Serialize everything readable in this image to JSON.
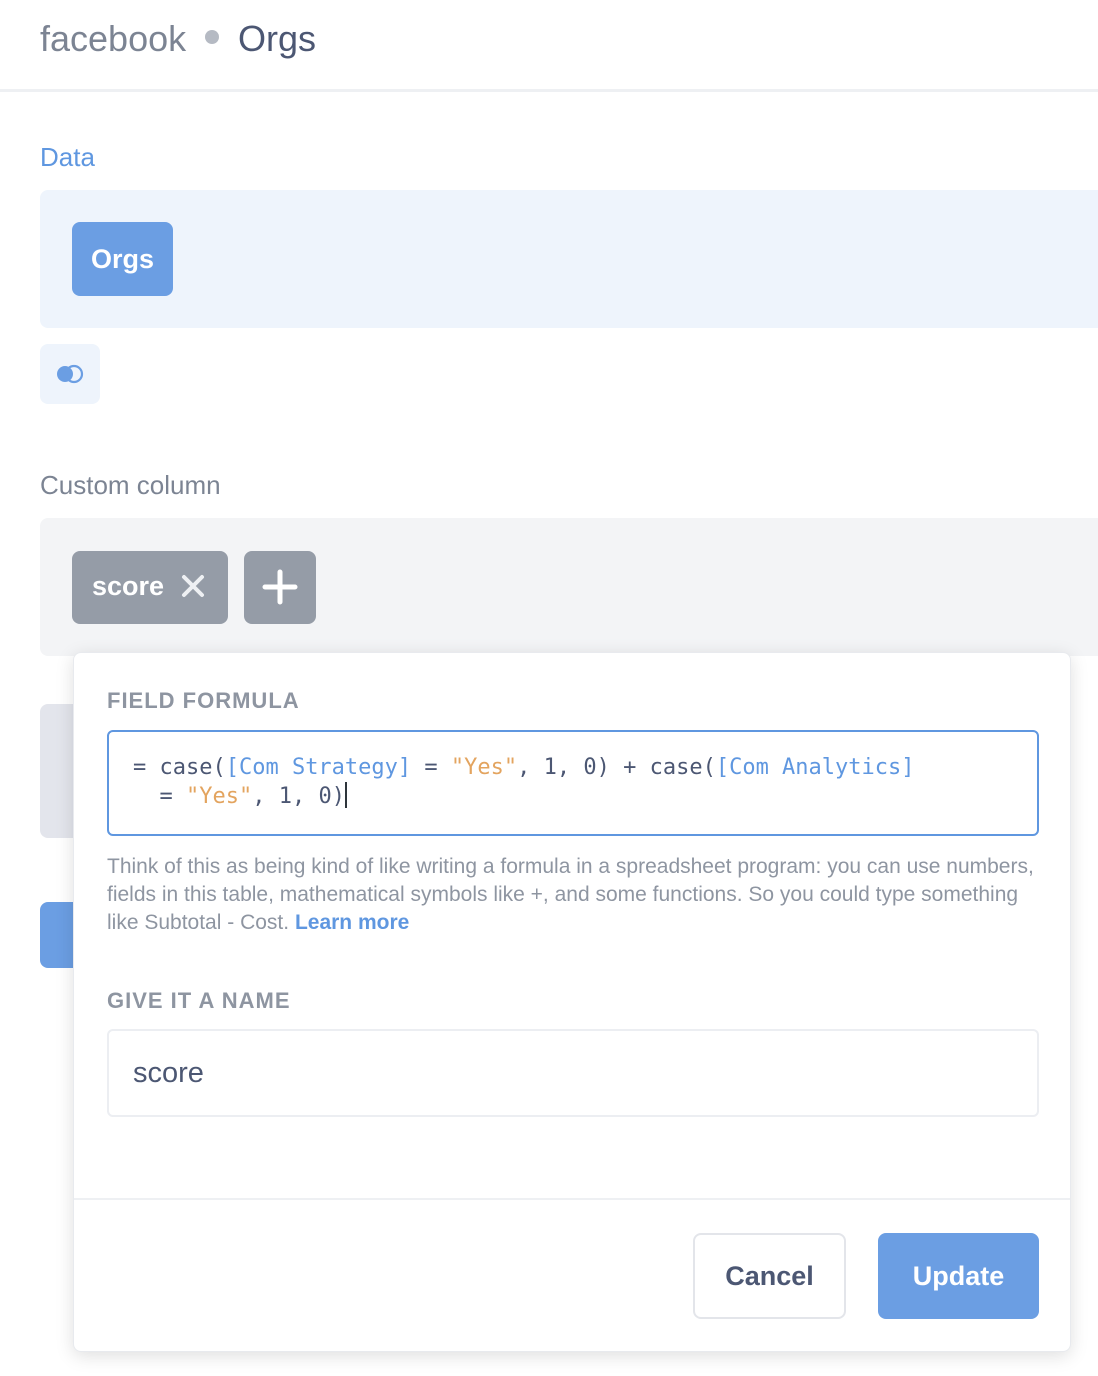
{
  "header": {
    "database": "facebook",
    "table": "Orgs"
  },
  "data_section": {
    "label": "Data",
    "table_pill": "Orgs",
    "join_icon": "join-icon"
  },
  "custom_column_section": {
    "label": "Custom column",
    "columns": [
      {
        "label": "score",
        "remove_icon": "close-icon"
      }
    ],
    "add_icon": "plus-icon"
  },
  "popover": {
    "formula_label": "FIELD FORMULA",
    "formula": {
      "tokens": [
        {
          "text": "= case(",
          "type": "plain"
        },
        {
          "text": "[Com Strategy]",
          "type": "field"
        },
        {
          "text": " = ",
          "type": "plain"
        },
        {
          "text": "\"Yes\"",
          "type": "string"
        },
        {
          "text": ", 1, 0) + case(",
          "type": "plain"
        },
        {
          "text": "[Com Analytics]",
          "type": "field"
        },
        {
          "text": "\n  = ",
          "type": "plain"
        },
        {
          "text": "\"Yes\"",
          "type": "string"
        },
        {
          "text": ", 1, 0)",
          "type": "plain"
        }
      ]
    },
    "help_text": "Think of this as being kind of like writing a formula in a spreadsheet program: you can use numbers, fields in this table, mathematical symbols like +, and some functions. So you could type something like Subtotal - Cost.",
    "learn_more": "Learn more",
    "name_label": "GIVE IT A NAME",
    "name_value": "score",
    "cancel_label": "Cancel",
    "update_label": "Update"
  },
  "colors": {
    "brand_blue": "#6b9ee3",
    "field_token": "#5f97e0",
    "string_token": "#e3a45f",
    "pill_gray": "#959ca7"
  }
}
